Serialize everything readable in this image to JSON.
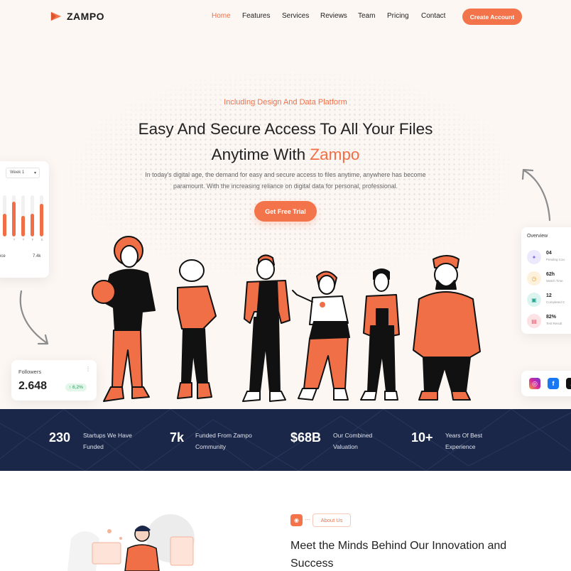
{
  "brand": {
    "name": "ZAMPO",
    "accent": "#f06f46",
    "navy": "#1a2748"
  },
  "nav": {
    "items": [
      {
        "label": "Home",
        "active": true
      },
      {
        "label": "Features"
      },
      {
        "label": "Services"
      },
      {
        "label": "Reviews"
      },
      {
        "label": "Team"
      },
      {
        "label": "Pricing"
      },
      {
        "label": "Contact"
      }
    ],
    "cta": "Create Account"
  },
  "hero": {
    "eyebrow": "Including Design And Data Platform",
    "headline_line1": "Easy And Secure Access To All Your Files",
    "headline_line2_prefix": "Anytime With ",
    "headline_line2_accent": "Zampo",
    "subtext_line1": "In today's digital age, the demand for easy and secure access to files anytime, anywhere has become",
    "subtext_line2": "paramount. With the increasing reliance on digital data for personal, professional.",
    "cta": "Get Free Trial"
  },
  "chart_card": {
    "week_select": "Week 1",
    "bars": [
      {
        "label": "",
        "fill": 0.55
      },
      {
        "label": "T",
        "fill": 0.85
      },
      {
        "label": "T",
        "fill": 0.5
      },
      {
        "label": "F",
        "fill": 0.55
      },
      {
        "label": "S",
        "fill": 0.8
      }
    ],
    "footer_left": "nce",
    "footer_right": "7.4k"
  },
  "followers_card": {
    "label": "Followers",
    "value": "2.648",
    "change": "↑ 6,2%",
    "menu_icon": "more-vertical-icon"
  },
  "overview_card": {
    "title": "Overview",
    "rows": [
      {
        "value": "04",
        "label": "Pending Cou",
        "icon": "school-icon",
        "color": "#7b6cf0",
        "bg": "#ece9fd"
      },
      {
        "value": "62h",
        "label": "Watch Time",
        "icon": "clock-icon",
        "color": "#e8a13a",
        "bg": "#fdf1dc"
      },
      {
        "value": "12",
        "label": "Completed C",
        "icon": "certificate-icon",
        "color": "#2aa692",
        "bg": "#dcf4ef"
      },
      {
        "value": "82%",
        "label": "Test Result",
        "icon": "clipboard-icon",
        "color": "#e2566c",
        "bg": "#fce1e5"
      }
    ]
  },
  "social_card": {
    "items": [
      {
        "icon": "instagram-icon",
        "glyph": "◎",
        "color": "#d6249f"
      },
      {
        "icon": "facebook-icon",
        "glyph": "f",
        "color": "#1877f2"
      },
      {
        "icon": "tiktok-icon",
        "glyph": "♪",
        "color": "#111111"
      }
    ]
  },
  "stats": [
    {
      "value": "230",
      "label_line1": "Startups We Have",
      "label_line2": "Funded"
    },
    {
      "value": "7k",
      "label_line1": "Funded From Zampo",
      "label_line2": "Community"
    },
    {
      "value": "$68B",
      "label_line1": "Our Combined",
      "label_line2": "Valuation"
    },
    {
      "value": "10+",
      "label_line1": "Years Of Best",
      "label_line2": "Experience"
    }
  ],
  "about": {
    "tag": "About Us",
    "title_line1": "Meet the Minds Behind Our Innovation and",
    "title_line2": "Success"
  }
}
